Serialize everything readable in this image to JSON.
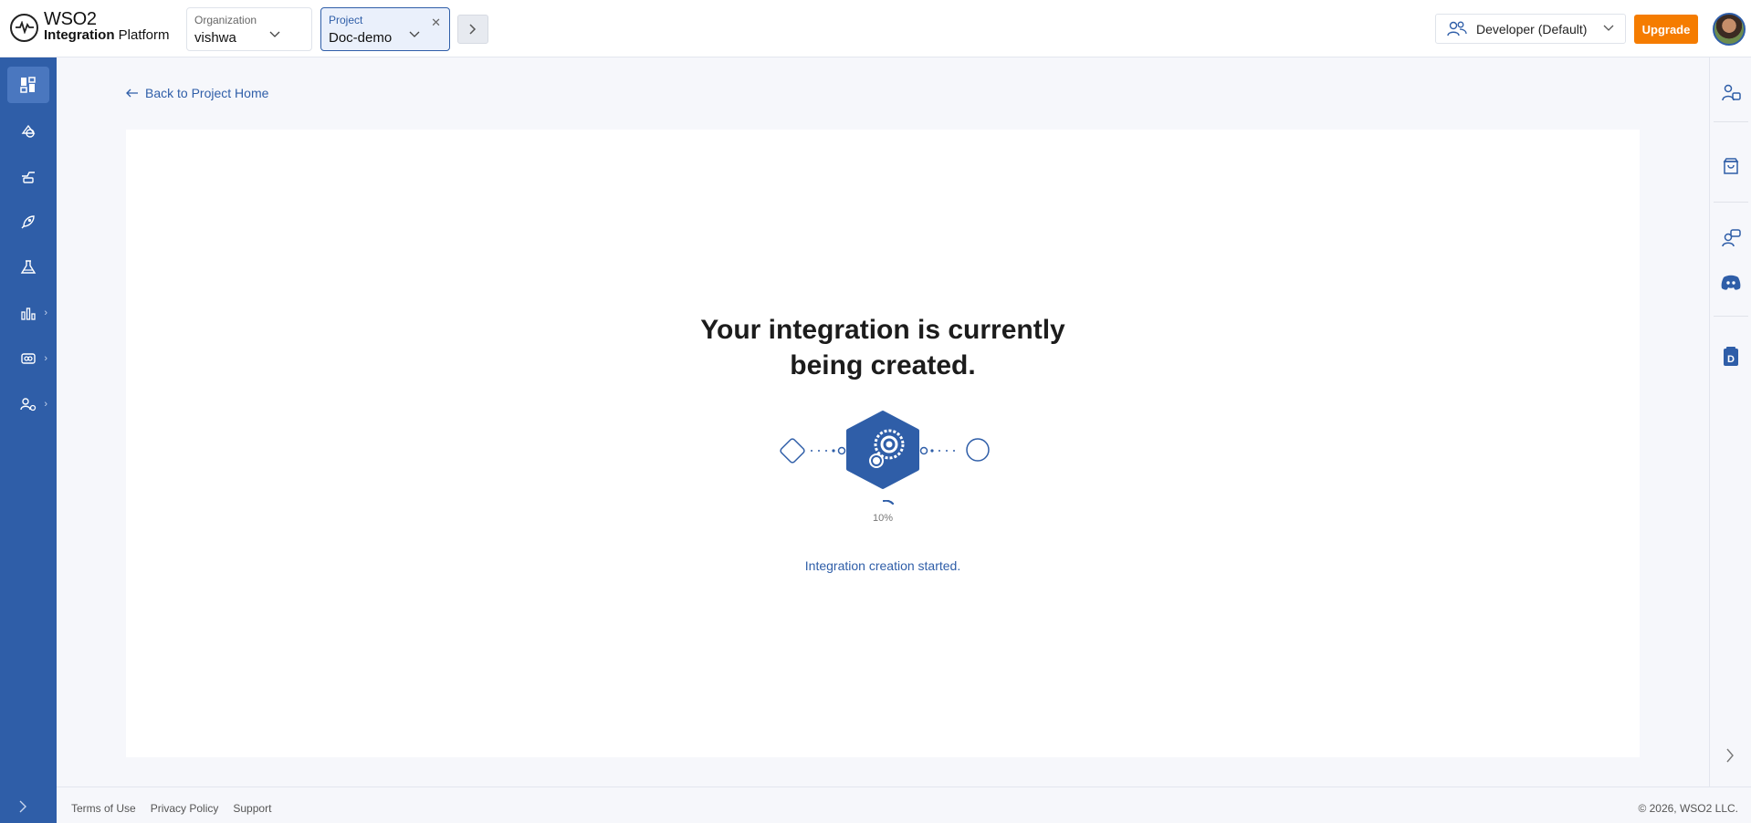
{
  "app": {
    "logo_line1": "WSO2",
    "logo_line2_bold": "Integration",
    "logo_line2_rest": " Platform"
  },
  "header": {
    "organization": {
      "label": "Organization",
      "value": "vishwa"
    },
    "project": {
      "label": "Project",
      "value": "Doc-demo"
    },
    "environment": "Developer (Default)",
    "upgrade_label": "Upgrade"
  },
  "sidebar": {
    "items": [
      {
        "icon": "overview-icon",
        "active": true,
        "expandable": false
      },
      {
        "icon": "develop-icon",
        "active": false,
        "expandable": false
      },
      {
        "icon": "deploy-icon",
        "active": false,
        "expandable": false
      },
      {
        "icon": "rocket-icon",
        "active": false,
        "expandable": false
      },
      {
        "icon": "test-flask-icon",
        "active": false,
        "expandable": false
      },
      {
        "icon": "observability-chart-icon",
        "active": false,
        "expandable": true
      },
      {
        "icon": "insights-icon",
        "active": false,
        "expandable": true
      },
      {
        "icon": "admin-settings-icon",
        "active": false,
        "expandable": true
      }
    ]
  },
  "right_rail": {
    "items": [
      "ai-assistant-icon",
      "marketplace-icon",
      "support-chat-icon",
      "discord-icon",
      "docs-icon"
    ]
  },
  "main": {
    "back_link": "Back to Project Home",
    "headline_line1": "Your integration is currently",
    "headline_line2": "being created.",
    "progress_percent": "10%",
    "progress_value": 0.1,
    "status_message": "Integration creation started."
  },
  "footer": {
    "terms": "Terms of Use",
    "privacy": "Privacy Policy",
    "support": "Support",
    "copyright": "© 2026, WSO2 LLC."
  },
  "colors": {
    "brand_blue": "#2f5ea8",
    "upgrade_orange": "#f57c00"
  }
}
